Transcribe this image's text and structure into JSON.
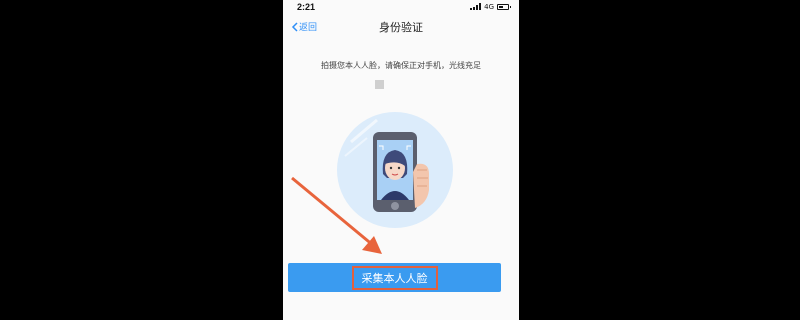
{
  "status_bar": {
    "time": "2:21",
    "network": "4G"
  },
  "nav": {
    "back_label": "返回",
    "title": "身份验证"
  },
  "content": {
    "instruction": "拍摄您本人人脸，请确保正对手机，光线充足"
  },
  "action": {
    "button_label": "采集本人人脸"
  },
  "colors": {
    "accent": "#3a9bf0",
    "highlight_border": "#e2603d",
    "annotation_arrow": "#e8643c"
  },
  "icons": [
    "chevron-left-icon",
    "signal-icon",
    "battery-icon",
    "selfie-phone-illustration",
    "annotation-arrow"
  ]
}
